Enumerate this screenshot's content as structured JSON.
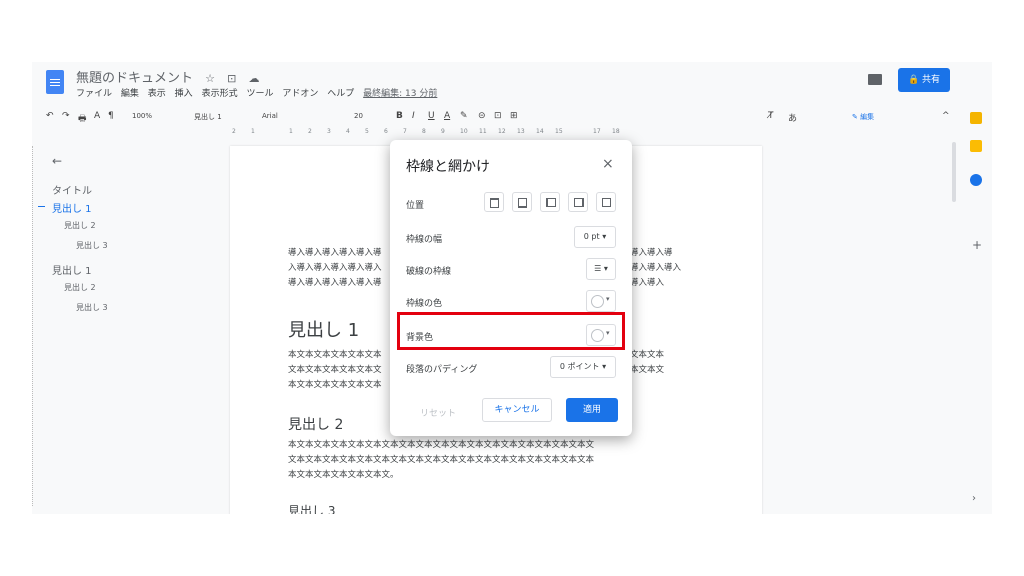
{
  "window": {
    "doc_title": "無題のドキュメント",
    "title_icons": [
      "☆",
      "⊡",
      "☁"
    ],
    "menu": [
      "ファイル",
      "編集",
      "表示",
      "挿入",
      "表示形式",
      "ツール",
      "アドオン",
      "ヘルプ"
    ],
    "last_edit": "最終編集: 13 分前",
    "share_label": "🔒 共有"
  },
  "toolbar": {
    "zoom": "100%",
    "style": "見出し 1",
    "font": "Arial",
    "font_size": "20",
    "edit_mode": "✎ 編集",
    "undo": "↶",
    "redo": "↷",
    "print": "🖶",
    "spell": "A",
    "paint": "¶",
    "bold": "B",
    "italic": "I",
    "underline": "U",
    "textcolor": "A",
    "highlight": "✎",
    "link": "⊝",
    "comment": "⊡",
    "image": "⊞",
    "input_method": "あ",
    "clear": "T̸",
    "collapse": "^"
  },
  "ruler": [
    "2",
    "1",
    "",
    "1",
    "2",
    "3",
    "4",
    "5",
    "6",
    "7",
    "8",
    "9",
    "10",
    "11",
    "12",
    "13",
    "14",
    "15",
    "",
    "17",
    "18"
  ],
  "outline": {
    "back": "←",
    "items": [
      {
        "label": "タイトル"
      },
      {
        "label": "見出し 1"
      },
      {
        "label": "見出し 2"
      },
      {
        "label": "見出し 3"
      },
      {
        "label": "見出し 1"
      },
      {
        "label": "見出し 2"
      },
      {
        "label": "見出し 3"
      }
    ]
  },
  "document": {
    "intro_lines": [
      "導入導入導入導入導入導",
      "入導入導入導入導入導入",
      "導入導入導入導入導入導"
    ],
    "intro_right": [
      "導入導入導",
      "導入導入導入",
      "導入導入"
    ],
    "heading1": "見出し 1",
    "body1": [
      "本文本文本文本文本文本",
      "文本文本文本文本文本文",
      "本文本文本文本文本文本"
    ],
    "body1_right": [
      "文本文本",
      "本文本文"
    ],
    "heading2": "見出し 2",
    "body2": [
      "本文本文本文本文本文本文本文本文本文本文本文本文本文本文本文本文本文本文",
      "文本文本文本文本文本文本文本文本文本文本文本文本文本文本文本文本文本文本",
      "本文本文本文本文本文本文。"
    ],
    "heading3": "見出し 3"
  },
  "dialog": {
    "title": "枠線と網かけ",
    "close": "×",
    "position_label": "位置",
    "border_width_label": "枠線の幅",
    "border_width_value": "0 pt ▾",
    "dash_label": "破線の枠線",
    "dash_value": "☰ ▾",
    "border_color_label": "枠線の色",
    "bg_color_label": "背景色",
    "padding_label": "段落のパディング",
    "padding_value": "0 ポイント ▾",
    "reset": "リセット",
    "cancel": "キャンセル",
    "apply": "適用",
    "dropdown_arrow": "▾"
  },
  "annotation": {
    "color": "#e3000f"
  },
  "side": {
    "plus": "+",
    "chevron": "›",
    "fab": "+"
  }
}
